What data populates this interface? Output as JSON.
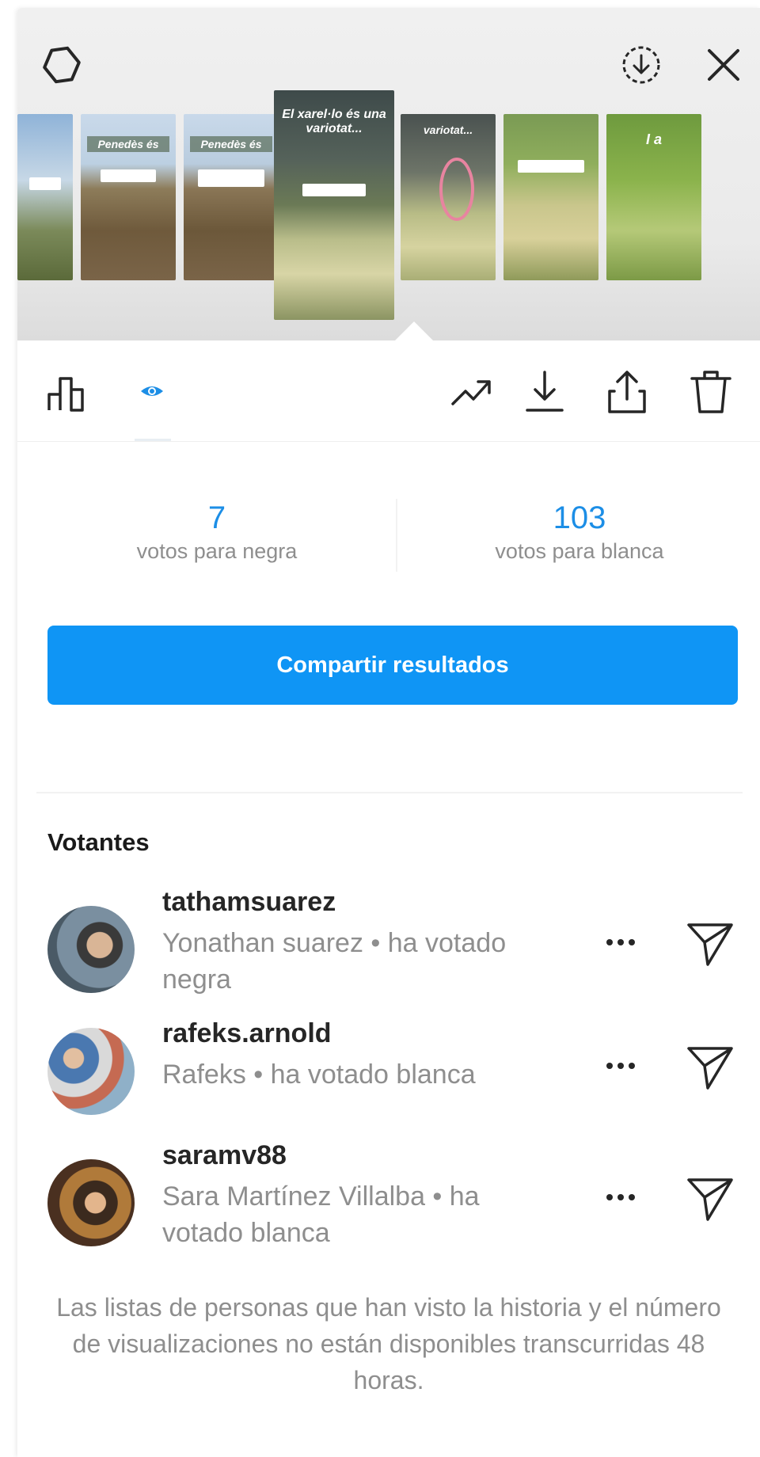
{
  "header": {
    "settings_icon": "settings-icon",
    "download_icon": "download-circle-icon",
    "close_icon": "close-icon"
  },
  "thumbnails": [
    {
      "caption": ""
    },
    {
      "caption": "Penedès és"
    },
    {
      "caption": "Penedès és"
    },
    {
      "caption": "El xarel·lo és una variotat..."
    },
    {
      "caption": "variotat..."
    },
    {
      "caption": ""
    },
    {
      "caption": "I a"
    }
  ],
  "toolbar": {
    "icons": [
      "bar-chart-icon",
      "eye-icon",
      "trending-icon",
      "download-icon",
      "share-icon",
      "trash-icon"
    ]
  },
  "stats": {
    "left": {
      "value": "7",
      "label": "votos para negra"
    },
    "right": {
      "value": "103",
      "label": "votos para blanca"
    }
  },
  "share_button": {
    "label": "Compartir resultados"
  },
  "voters": {
    "title": "Votantes",
    "items": [
      {
        "username": "tathamsuarez",
        "subline": "Yonathan suarez • ha votado negra"
      },
      {
        "username": "rafeks.arnold",
        "subline": "Rafeks • ha votado blanca"
      },
      {
        "username": "saramv88",
        "subline": "Sara Martínez Villalba • ha votado blanca"
      }
    ]
  },
  "footnote": "Las listas de personas que han visto la historia y el número de visualizaciones no están disponibles transcurridas 48 horas.",
  "colors": {
    "accent": "#0f95f5",
    "stat_blue": "#1c8ee6",
    "muted": "#8e8e8e"
  }
}
